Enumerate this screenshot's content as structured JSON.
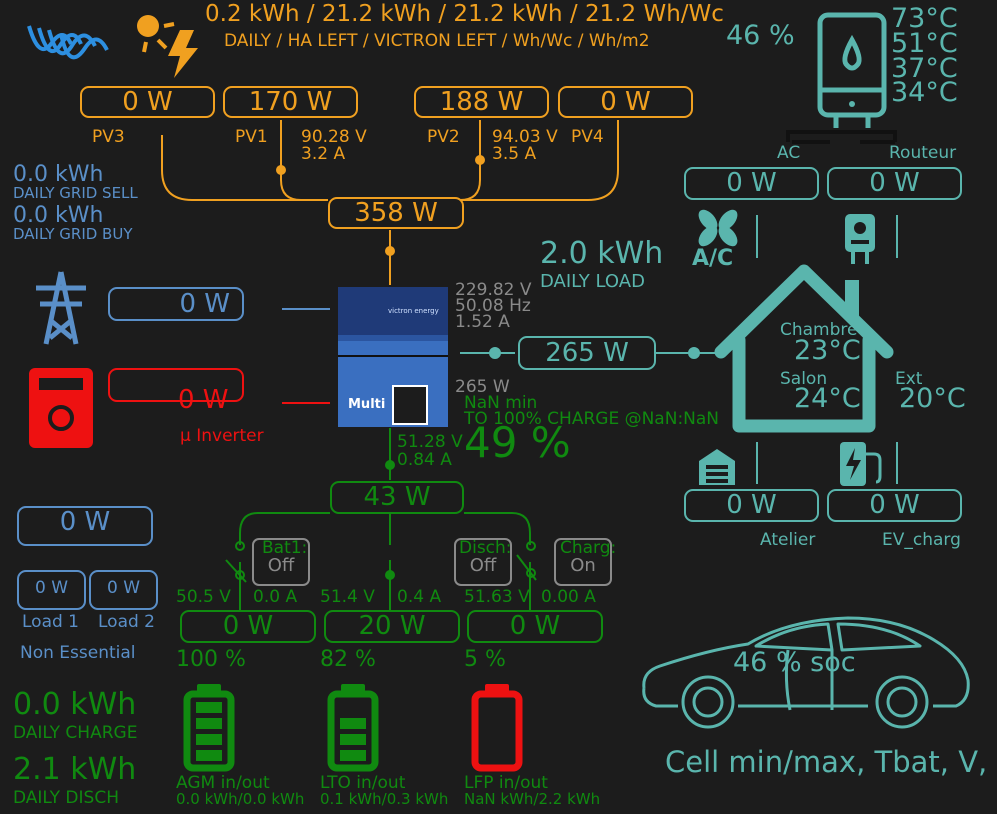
{
  "solar": {
    "summary_values": "0.2 kWh / 21.2 kWh / 21.2 kWh / 21.2 Wh/Wc",
    "summary_legend": "DAILY / HA LEFT / VICTRON LEFT / Wh/Wc / Wh/m2",
    "pv3": {
      "power": "0 W",
      "label": "PV3"
    },
    "pv1": {
      "power": "170 W",
      "label": "PV1",
      "voltage": "90.28 V",
      "current": "3.2 A"
    },
    "pv2": {
      "power": "188 W",
      "label": "PV2",
      "voltage": "94.03 V",
      "current": "3.5 A"
    },
    "pv4": {
      "power": "0 W",
      "label": "PV4"
    },
    "total": "358 W"
  },
  "grid": {
    "sell_value": "0.0 kWh",
    "sell_label": "DAILY GRID SELL",
    "buy_value": "0.0 kWh",
    "buy_label": "DAILY GRID BUY",
    "power": "0 W"
  },
  "micro_inverter": {
    "power": "0 W",
    "label": "µ Inverter"
  },
  "inverter": {
    "device_label": "Multi",
    "brand_label": "victron energy",
    "ac_voltage": "229.82 V",
    "frequency": "50.08 Hz",
    "ac_current": "1.52 A",
    "output_power": "265 W",
    "dc_voltage": "51.28 V",
    "dc_current": "0.84 A"
  },
  "load": {
    "daily_value": "2.0 kWh",
    "daily_label": "DAILY LOAD",
    "power": "265 W"
  },
  "battery_summary": {
    "time_left": "NaN min",
    "charge_eta": "TO 100% CHARGE @NaN:NaN",
    "soc": "49 %",
    "power": "43 W"
  },
  "water_heater": {
    "percent": "46 %",
    "temps": [
      "73°C",
      "51°C",
      "37°C",
      "34°C"
    ]
  },
  "devices": {
    "ac": {
      "label": "AC",
      "power": "0 W",
      "icon_text": "A/C"
    },
    "routeur": {
      "label": "Routeur",
      "power": "0 W"
    },
    "atelier": {
      "label": "Atelier",
      "power": "0 W"
    },
    "ev": {
      "label": "EV_charg",
      "power": "0 W"
    }
  },
  "house": {
    "chambre_label": "Chambre",
    "chambre_temp": "23°C",
    "salon_label": "Salon",
    "salon_temp": "24°C",
    "ext_label": "Ext",
    "ext_temp": "20°C"
  },
  "non_essential": {
    "total": "0 W",
    "load1": {
      "power": "0 W",
      "label": "Load 1"
    },
    "load2": {
      "power": "0 W",
      "label": "Load 2"
    },
    "label": "Non Essential"
  },
  "switches": {
    "bat1": {
      "label": "Bat1:",
      "state": "Off"
    },
    "disch": {
      "label": "Disch:",
      "state": "Off"
    },
    "charg": {
      "label": "Charg:",
      "state": "On"
    }
  },
  "batteries": [
    {
      "voltage": "50.5 V",
      "current": "0.0 A",
      "power": "0 W",
      "soc": "100 %",
      "name": "AGM in/out",
      "energy": "0.0 kWh/0.0 kWh",
      "color": "#108a10",
      "fill": 1.0
    },
    {
      "voltage": "51.4 V",
      "current": "0.4 A",
      "power": "20 W",
      "soc": "82 %",
      "name": "LTO in/out",
      "energy": "0.1 kWh/0.3 kWh",
      "color": "#108a10",
      "fill": 0.82
    },
    {
      "voltage": "51.63 V",
      "current": "0.00 A",
      "power": "0 W",
      "soc": "5 %",
      "name": "LFP in/out",
      "energy": "NaN kWh/2.2 kWh",
      "color": "#ee1111",
      "fill": 0.05
    }
  ],
  "daily_battery": {
    "charge_value": "0.0 kWh",
    "charge_label": "DAILY CHARGE",
    "disch_value": "2.1 kWh",
    "disch_label": "DAILY DISCH"
  },
  "car": {
    "soc": "46 % soc",
    "cell_info": "Cell min/max, Tbat, V, I"
  },
  "colors": {
    "background": "#1c1c1c",
    "solar": "#f0a020",
    "load": "#5ab5ad",
    "grid": "#5a8fc8",
    "battery": "#108a10",
    "alert": "#ee1111",
    "inactive": "#8a8a8a"
  }
}
